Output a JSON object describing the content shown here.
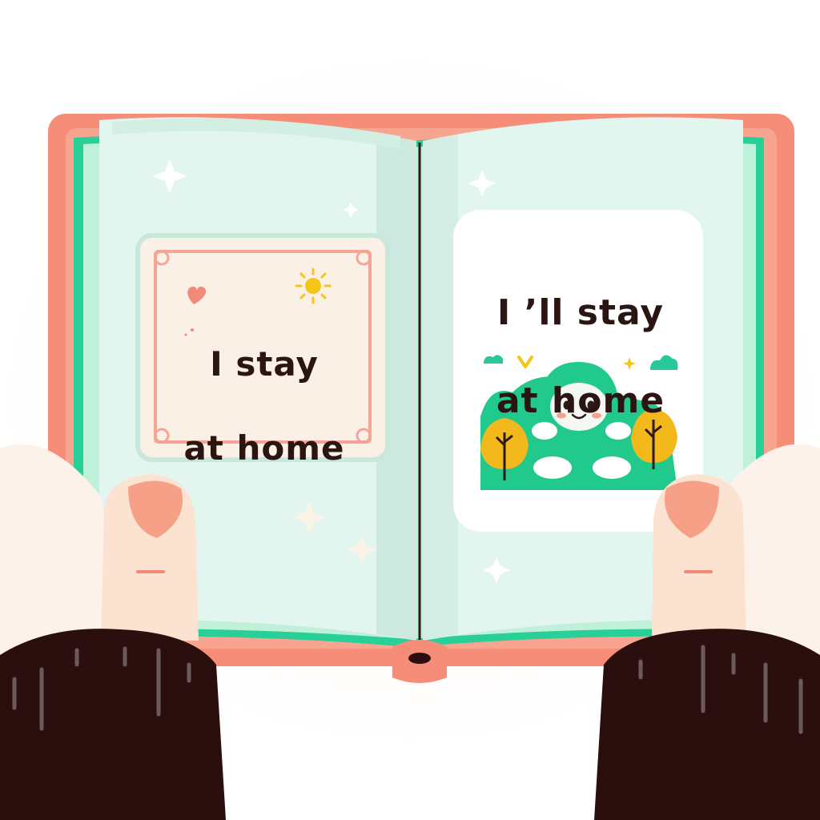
{
  "left_page": {
    "line1": "I stay",
    "line2": "at home"
  },
  "right_page": {
    "line1": "I ’ll stay",
    "line2": "at home"
  },
  "colors": {
    "cover": "#f58d78",
    "page": "#e3f5ef",
    "page_edge": "#28cf96",
    "mascot": "#22c98c",
    "tree": "#f2b81c",
    "sleeve": "#2b0f0e",
    "skin": "#fbe2d1",
    "nail": "#f7a088"
  }
}
